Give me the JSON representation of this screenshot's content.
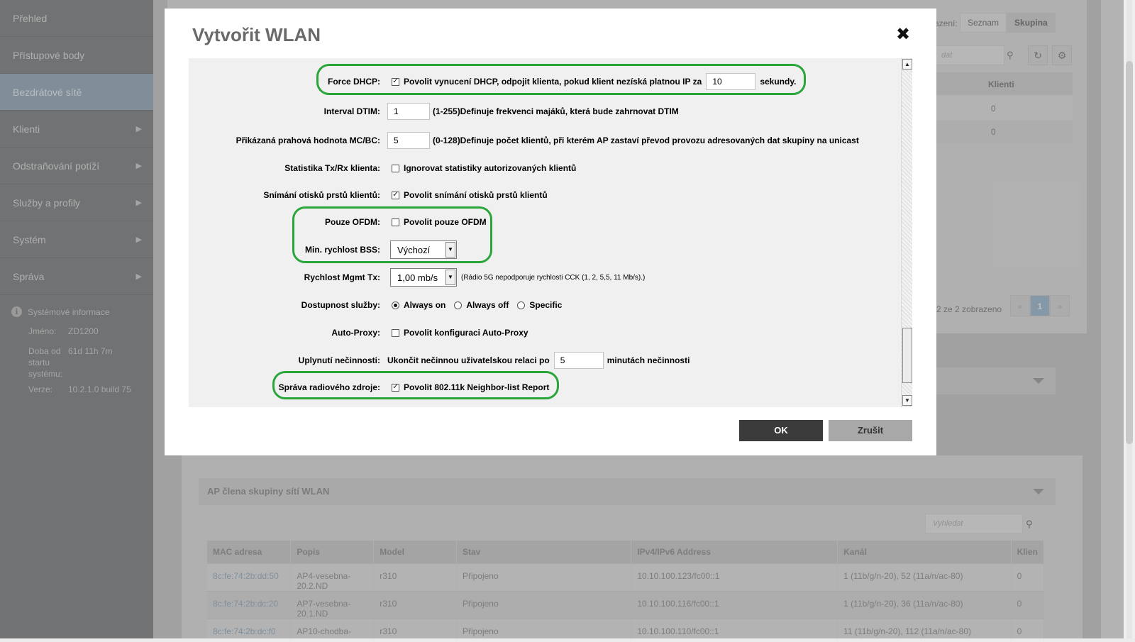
{
  "sidebar": {
    "items": [
      {
        "label": "Přehled",
        "arrow": false
      },
      {
        "label": "Přístupové body",
        "arrow": false
      },
      {
        "label": "Bezdrátové sítě",
        "arrow": false,
        "active": true
      },
      {
        "label": "Klienti",
        "arrow": true
      },
      {
        "label": "Odstraňování potíží",
        "arrow": true
      },
      {
        "label": "Služby a profily",
        "arrow": true
      },
      {
        "label": "Systém",
        "arrow": true
      },
      {
        "label": "Správa",
        "arrow": true
      }
    ],
    "arrow_glyph": "▶",
    "sysinfo": {
      "title": "Systémové informace",
      "name_label": "Jméno:",
      "name_value": "ZD1200",
      "uptime_label": "Doba od startu systému:",
      "uptime_value": "61d 11h 7m",
      "version_label": "Verze:",
      "version_value": "10.2.1.0 build 75"
    }
  },
  "background": {
    "view_label": "azení:",
    "view_list": "Seznam",
    "view_group": "Skupina",
    "search_placeholder": "dat",
    "clients_header": "Klienti",
    "clients_values": [
      "0",
      "0"
    ],
    "pager_info": "2 ze 2 zobrazeno",
    "pager_prev": "«",
    "pager_current": "1",
    "pager_next": "»",
    "ap_section_title": "AP člena skupiny sítí WLAN",
    "ap_search_placeholder": "Vyhledat",
    "ap_table": {
      "headers": [
        "MAC adresa",
        "Popis",
        "Model",
        "Stav",
        "IPv4/IPv6 Address",
        "Kanál",
        "Klien"
      ],
      "rows": [
        [
          "8c:fe:74:2b:dd:50",
          "AP4-vesebna-20.2.ND",
          "r310",
          "Připojeno",
          "10.10.100.123/fc00::1",
          "1 (11b/g/n-20), 52 (11a/n/ac-80)",
          "0"
        ],
        [
          "8c:fe:74:2b:dc:20",
          "AP7-vesebna-20.1.ND",
          "r310",
          "Připojeno",
          "10.10.100.116/fc00::1",
          "1 (11b/g/n-20), 36 (11a/n/ac-80)",
          "0"
        ],
        [
          "8c:fe:74:2b:dc:f0",
          "AP10-chodba-",
          "r310",
          "Připojeno",
          "10.10.100.110/fc00::1",
          "11 (11b/g/n-20), 112 (11a/n/ac-80)",
          "0"
        ]
      ]
    }
  },
  "dialog": {
    "title": "Vytvořit WLAN",
    "close_glyph": "✖",
    "fields": {
      "force_dhcp": {
        "label": "Force DHCP:",
        "checked": true,
        "text": "Povolit vynucení DHCP, odpojit klienta, pokud klient nezíská platnou IP za",
        "value": "10",
        "suffix": "sekundy."
      },
      "dtim": {
        "label": "Interval DTIM:",
        "value": "1",
        "hint": "(1-255)Definuje frekvenci majáků, která bude zahrnovat DTIM"
      },
      "mcbc": {
        "label": "Přikázaná prahová hodnota MC/BC:",
        "value": "5",
        "hint": "(0-128)Definuje počet klientů, při kterém AP zastaví převod provozu adresovaných dat skupiny na unicast"
      },
      "txrx": {
        "label": "Statistika Tx/Rx klienta:",
        "checked": false,
        "text": "Ignorovat statistiky autorizovaných klientů"
      },
      "fingerprint": {
        "label": "Snímání otisků prstů klientů:",
        "checked": true,
        "text": "Povolit snímání otisků prstů klientů"
      },
      "ofdm": {
        "label": "Pouze OFDM:",
        "checked": false,
        "text": "Povolit pouze OFDM"
      },
      "bss_rate": {
        "label": "Min. rychlost BSS:",
        "selected": "Výchozí"
      },
      "mgmt_tx": {
        "label": "Rychlost Mgmt Tx:",
        "selected": "1,00 mb/s",
        "hint": "(Rádio 5G nepodporuje rychlosti CCK (1, 2, 5,5, 11 Mb/s).)"
      },
      "availability": {
        "label": "Dostupnost služby:",
        "options": [
          "Always on",
          "Always off",
          "Specific"
        ],
        "selected": "Always on"
      },
      "auto_proxy": {
        "label": "Auto-Proxy:",
        "checked": false,
        "text": "Povolit konfiguraci Auto-Proxy"
      },
      "inactivity": {
        "label": "Uplynutí nečinnosti:",
        "text": "Ukončit nečinnou uživatelskou relaci po",
        "value": "5",
        "suffix": "minutách nečinnosti"
      },
      "rrm": {
        "label": "Správa radiového zdroje:",
        "checked": true,
        "text": "Povolit 802.11k Neighbor-list Report"
      }
    },
    "ok_label": "OK",
    "cancel_label": "Zrušit"
  },
  "glyphs": {
    "check": "✓",
    "dropdown": "▼",
    "scroll_up": "▲",
    "scroll_down": "▼",
    "search": "⚲",
    "refresh": "↻",
    "gear": "⚙",
    "info": "i"
  },
  "colors": {
    "highlight": "#2aa53a",
    "active_nav": "#a0b6c6",
    "ok_button": "#3b3b3b"
  }
}
